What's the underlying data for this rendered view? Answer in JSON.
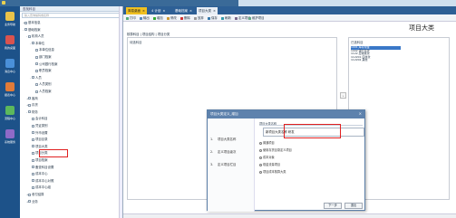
{
  "tree": {
    "header": "查找科目",
    "search_placeholder": "输入查询编码或名称",
    "nodes": [
      {
        "label": "基本信息",
        "level": 0,
        "toggle": "+"
      },
      {
        "label": "基础档案",
        "level": 0,
        "toggle": "-"
      },
      {
        "label": "机构人员",
        "level": 1,
        "toggle": "-"
      },
      {
        "label": "本单位",
        "level": 2,
        "toggle": "-"
      },
      {
        "label": "本单位信息",
        "level": 3,
        "toggle": ""
      },
      {
        "label": "部门档案",
        "level": 3,
        "toggle": ""
      },
      {
        "label": "公司银行档案",
        "level": 3,
        "toggle": ""
      },
      {
        "label": "职员档案",
        "level": 3,
        "toggle": ""
      },
      {
        "label": "人员",
        "level": 2,
        "toggle": "-"
      },
      {
        "label": "人员类别",
        "level": 3,
        "toggle": ""
      },
      {
        "label": "人员档案",
        "level": 3,
        "toggle": ""
      },
      {
        "label": "客商",
        "level": 1,
        "toggle": "+"
      },
      {
        "label": "存货",
        "level": 1,
        "toggle": "+"
      },
      {
        "label": "财务",
        "level": 1,
        "toggle": "-"
      },
      {
        "label": "会计科目",
        "level": 2,
        "toggle": ""
      },
      {
        "label": "凭证类别",
        "level": 2,
        "toggle": ""
      },
      {
        "label": "外币设置",
        "level": 2,
        "toggle": ""
      },
      {
        "label": "项目目录",
        "level": 2,
        "toggle": ""
      },
      {
        "label": "项目大类",
        "level": 2,
        "toggle": ""
      },
      {
        "label": "项目分类",
        "level": 2,
        "toggle": ""
      },
      {
        "label": "项目档案",
        "level": 2,
        "toggle": ""
      },
      {
        "label": "备查科目设置",
        "level": 2,
        "toggle": ""
      },
      {
        "label": "成本中心",
        "level": 2,
        "toggle": ""
      },
      {
        "label": "成本中心对照",
        "level": 2,
        "toggle": ""
      },
      {
        "label": "成本中心组",
        "level": 2,
        "toggle": ""
      },
      {
        "label": "收付结算",
        "level": 1,
        "toggle": "+"
      },
      {
        "label": "业务",
        "level": 1,
        "toggle": "+"
      }
    ]
  },
  "rail": [
    {
      "label": "业务导航",
      "color": "#e8c24a"
    },
    {
      "label": "我的桌面",
      "color": "#d9534f"
    },
    {
      "label": "消息中心",
      "color": "#4a90d9"
    },
    {
      "label": "报表中心",
      "color": "#e07b39"
    },
    {
      "label": "流程中心",
      "color": "#5cb85c"
    },
    {
      "label": "系统服务",
      "color": "#8e6ac8"
    }
  ],
  "tabs": [
    {
      "label": "简易桌面",
      "state": "active"
    },
    {
      "label": "4 计划",
      "state": ""
    },
    {
      "label": "基础档案",
      "state": ""
    },
    {
      "label": "项目大类",
      "state": "sel"
    }
  ],
  "toolbar": [
    {
      "label": "打印",
      "color": "#5a7"
    },
    {
      "label": "输出",
      "color": "#58b"
    },
    {
      "label": "增加",
      "color": "#3a3"
    },
    {
      "label": "修改",
      "color": "#c93"
    },
    {
      "label": "删除",
      "color": "#c33"
    },
    {
      "label": "放弃",
      "color": "#999"
    },
    {
      "label": "保存",
      "color": "#37a"
    },
    {
      "label": "刷新",
      "color": "#39a"
    },
    {
      "label": "定义项目",
      "color": "#768"
    },
    {
      "label": "维护项目",
      "color": "#6a8"
    }
  ],
  "content": {
    "title": "项目大类",
    "subtabs": "核算科目  |  项目结构  |  项目分类",
    "left_box_label": "待选科目",
    "right_box_label": "已选科目",
    "move_label": "»",
    "right_items": [
      "1001 库存现金",
      "1002 银行存款",
      "1122 应收账款",
      "112201 应收款",
      "112202 其他"
    ]
  },
  "dialog": {
    "title": "项目大类定义_增加",
    "close": "×",
    "steps": [
      {
        "num": "1.",
        "label": "项目大类名称"
      },
      {
        "num": "2.",
        "label": "定义项目级次"
      },
      {
        "num": "3.",
        "label": "定义项目栏目"
      }
    ],
    "section_label": "项目大类名称",
    "input_value": "新项目大类名称  研发",
    "options": [
      "普通项目",
      "使用存货目录定义项目",
      "成本对象",
      "现金流量项目",
      "项目成本核算大类"
    ],
    "buttons": {
      "prev": "上一步",
      "next": "下一步",
      "finish": "完成",
      "cancel": "退出"
    }
  }
}
